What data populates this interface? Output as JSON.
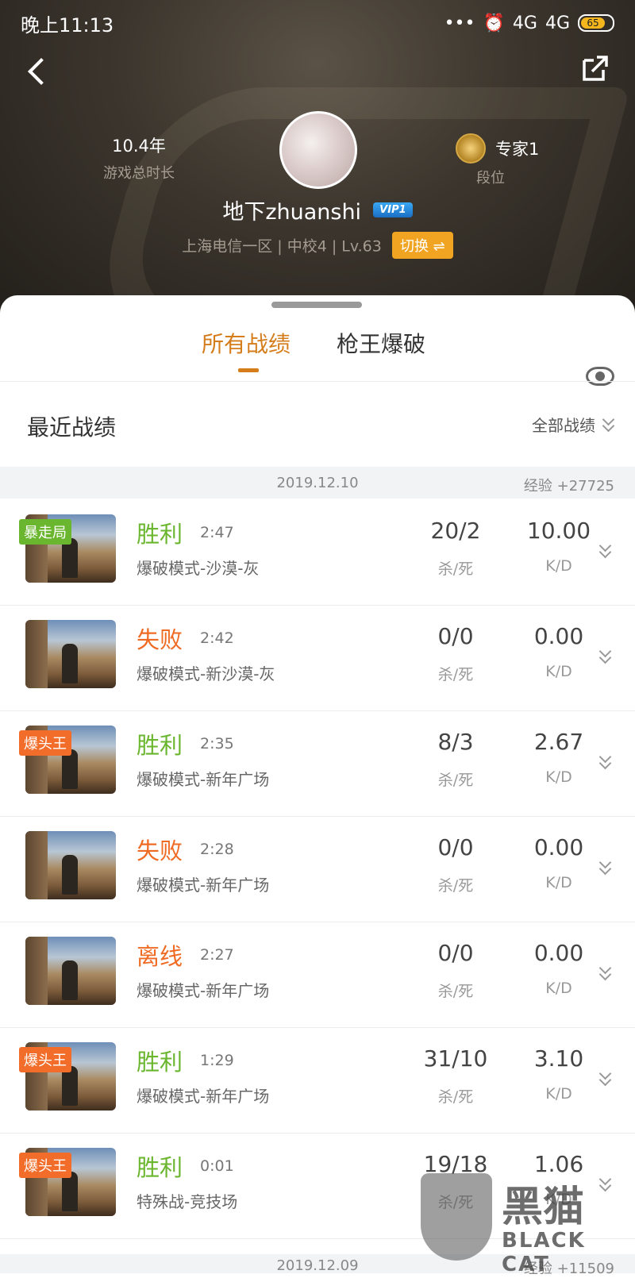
{
  "status_bar": {
    "time": "晚上11:13",
    "signal1": "4G",
    "signal2": "4G",
    "battery": "65"
  },
  "profile": {
    "play_years": "10.4年",
    "play_years_label": "游戏总时长",
    "rank": "专家1",
    "rank_label": "段位",
    "name": "地下zhuanshi",
    "vip": "VIP1",
    "server": "上海电信一区 | 中校4 | Lv.63",
    "switch_label": "切换 ⇌"
  },
  "tabs": [
    {
      "label": "所有战绩"
    },
    {
      "label": "枪王爆破"
    }
  ],
  "section": {
    "title": "最近战绩",
    "filter": "全部战绩"
  },
  "date_groups": [
    {
      "date": "2019.12.10",
      "exp": "经验 +27725"
    },
    {
      "date": "2019.12.09",
      "exp": "经验 +11509"
    }
  ],
  "matches": [
    {
      "badge": "暴走局",
      "badge_color": "#6ab62e",
      "result": "胜利",
      "time": "2:47",
      "mode": "爆破模式-沙漠-灰",
      "kills_deaths": "20/2",
      "kd_label": "杀/死",
      "kd": "10.00",
      "kd_unit": "K/D"
    },
    {
      "badge": "",
      "result": "失败",
      "time": "2:42",
      "mode": "爆破模式-新沙漠-灰",
      "kills_deaths": "0/0",
      "kd_label": "杀/死",
      "kd": "0.00",
      "kd_unit": "K/D"
    },
    {
      "badge": "爆头王",
      "badge_color": "#f26d2a",
      "result": "胜利",
      "time": "2:35",
      "mode": "爆破模式-新年广场",
      "kills_deaths": "8/3",
      "kd_label": "杀/死",
      "kd": "2.67",
      "kd_unit": "K/D"
    },
    {
      "badge": "",
      "result": "失败",
      "time": "2:28",
      "mode": "爆破模式-新年广场",
      "kills_deaths": "0/0",
      "kd_label": "杀/死",
      "kd": "0.00",
      "kd_unit": "K/D"
    },
    {
      "badge": "",
      "result": "离线",
      "time": "2:27",
      "mode": "爆破模式-新年广场",
      "kills_deaths": "0/0",
      "kd_label": "杀/死",
      "kd": "0.00",
      "kd_unit": "K/D"
    },
    {
      "badge": "爆头王",
      "badge_color": "#f26d2a",
      "result": "胜利",
      "time": "1:29",
      "mode": "爆破模式-新年广场",
      "kills_deaths": "31/10",
      "kd_label": "杀/死",
      "kd": "3.10",
      "kd_unit": "K/D"
    },
    {
      "badge": "爆头王",
      "badge_color": "#f26d2a",
      "result": "胜利",
      "time": "0:01",
      "mode": "特殊战-竞技场",
      "kills_deaths": "19/18",
      "kd_label": "杀/死",
      "kd": "1.06",
      "kd_unit": "K/D"
    }
  ],
  "watermark": {
    "text": "黑猫",
    "sub": "BLACK CAT"
  },
  "colors": {
    "accent": "#d47d1a",
    "win": "#6ab62e",
    "loss": "#ef6b24",
    "switch": "#f0a422"
  },
  "icons": {
    "back": "back-arrow-icon",
    "share": "share-icon",
    "eye": "eye-icon",
    "expand": "chevron-down-icon"
  }
}
